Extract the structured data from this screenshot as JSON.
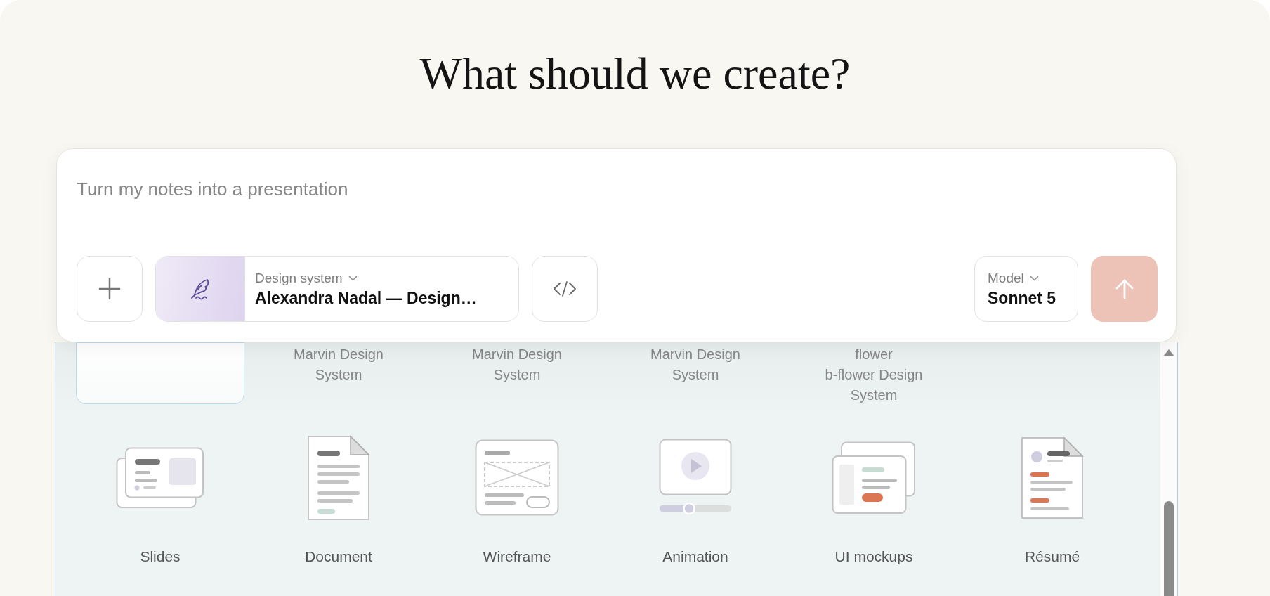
{
  "title": "What should we create?",
  "prompt": {
    "placeholder": "Turn my notes into a presentation"
  },
  "design_system": {
    "label": "Design system",
    "value": "Alexandra Nadal — Design…"
  },
  "model": {
    "label": "Model",
    "value": "Sonnet 5"
  },
  "send": {
    "disabled": true
  },
  "design_systems": [
    {
      "selected": true
    },
    {
      "label": "Marvin Design\nSystem",
      "selected": false
    },
    {
      "label": "Marvin Design\nSystem",
      "selected": false
    },
    {
      "label": "Marvin Design\nSystem",
      "selected": false
    },
    {
      "label": "flower\nb-flower Design\nSystem",
      "selected": false
    }
  ],
  "formats": [
    {
      "kind": "slides",
      "label": "Slides"
    },
    {
      "kind": "document",
      "label": "Document"
    },
    {
      "kind": "wireframe",
      "label": "Wireframe"
    },
    {
      "kind": "animation",
      "label": "Animation"
    },
    {
      "kind": "mockups",
      "label": "UI mockups"
    },
    {
      "kind": "resume",
      "label": "Résumé"
    }
  ]
}
